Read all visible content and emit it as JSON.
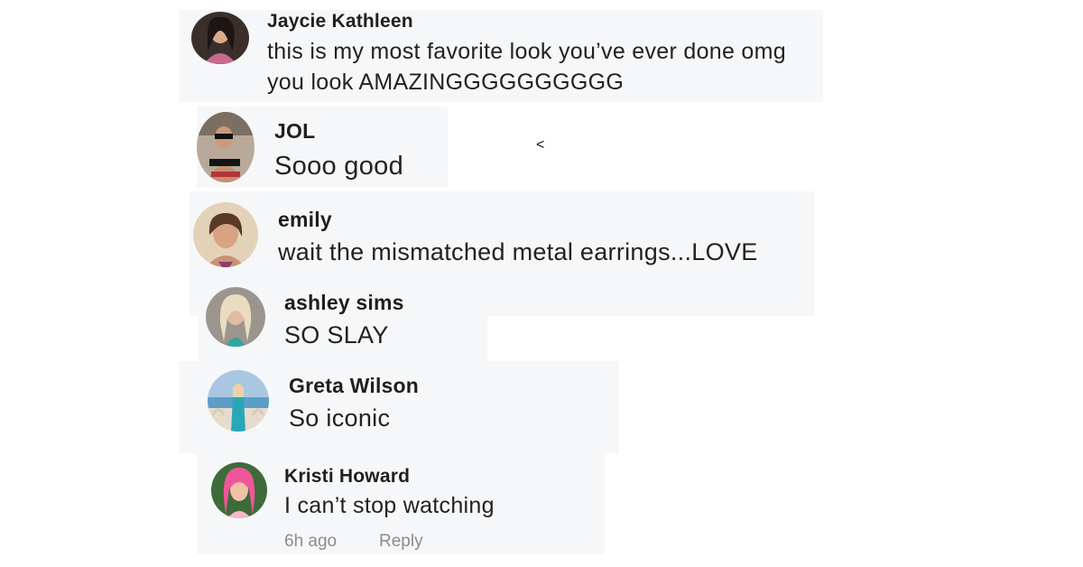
{
  "comments": [
    {
      "author": "Jaycie Kathleen",
      "text_line1": "this is my most favorite look you’ve ever done omg",
      "text_line2": "you look AMAZINGGGGGGGGGG",
      "avatar_icon": "profile-photo-icon"
    },
    {
      "author": "JOL",
      "text": "Sooo good",
      "avatar_icon": "profile-photo-icon"
    },
    {
      "author": "emily",
      "text": "wait the mismatched metal earrings...LOVE",
      "avatar_icon": "profile-photo-icon"
    },
    {
      "author": "ashley sims",
      "text": "SO SLAY",
      "avatar_icon": "profile-photo-icon"
    },
    {
      "author": "Greta Wilson",
      "text": "So iconic",
      "avatar_icon": "profile-photo-icon"
    },
    {
      "author": "Kristi Howard",
      "text": "I can’t stop watching",
      "time": "6h ago",
      "reply_label": "Reply",
      "avatar_icon": "profile-photo-icon"
    }
  ],
  "stray_glyph": "<",
  "colors": {
    "card_background": "#f6f7f9",
    "text": "#222222",
    "meta_text": "#8a8b91"
  }
}
